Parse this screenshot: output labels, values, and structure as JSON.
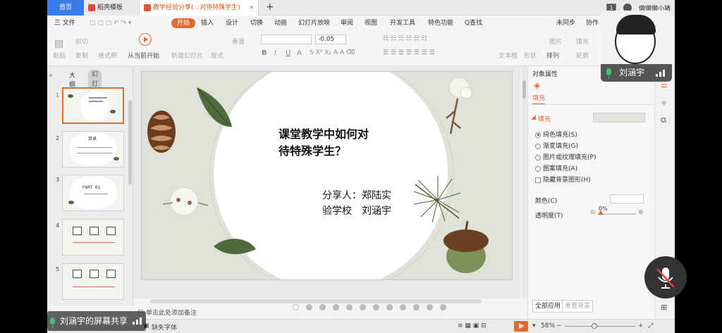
{
  "tabs": {
    "home": "首页",
    "template": "稻壳模板",
    "document": "教学经验分享(...对待特殊学生)"
  },
  "titlebar": {
    "badge": "1",
    "user": "懒懒懒小猪"
  },
  "menu": {
    "file": "三 文件",
    "start": "开始",
    "insert": "插入",
    "design": "设计",
    "switch": "切换",
    "animation": "动画",
    "slideshow": "幻灯片放映",
    "review": "审阅",
    "view": "视图",
    "devtools": "开发工具",
    "special": "特色功能",
    "search": "Q查找",
    "sync": "未同步",
    "collab": "协作",
    "share": "分享"
  },
  "ribbon": {
    "paste": "粘贴",
    "cut": "剪切",
    "copy": "复制",
    "format_painter": "格式刷",
    "play_from_current": "从当前开始",
    "new_slide": "新建幻灯片",
    "layout": "版式",
    "reset": "重置",
    "size": "-0.05",
    "textbox": "文本框",
    "shape": "形状",
    "arrange": "排列",
    "picture": "图片",
    "fill": "填充",
    "outline": "轮廓"
  },
  "left_panel": {
    "outline_tab": "大纲",
    "slides_tab": "幻灯片",
    "thumb_numbers": [
      "1",
      "2",
      "3",
      "4",
      "5"
    ],
    "thumb2_title": "目录",
    "thumb3_title": "PART 01"
  },
  "slide": {
    "title_line1": "课堂教学中如何对",
    "title_line2": "待特殊学生？",
    "share_line1": "分享人：郑陆实",
    "share_line2": "验学校　刘涵宇"
  },
  "notes": {
    "placeholder": "单击此处添加备注"
  },
  "properties": {
    "header": "对象属性",
    "tab_fill": "填充",
    "section_fill": "填充",
    "options": [
      "纯色填充(S)",
      "渐变填充(G)",
      "图片或纹理填充(P)",
      "图案填充(A)"
    ],
    "hide_bg": "隐藏背景图形(H)",
    "color_label": "颜色(C)",
    "transparency_label": "透明度(T)",
    "transparency_value": "0%",
    "apply_all": "全部应用",
    "reset_bg": "重置背景"
  },
  "status": {
    "missing_font": "缺失字体",
    "zoom": "58%"
  },
  "call": {
    "speaker": "刘涵宇",
    "screen_share": "刘涵宇的屏幕共享"
  },
  "colors": {
    "accent": "#e36a2e",
    "tab_blue": "#3b7ce8",
    "slide_bg": "#dfe2d9",
    "mic_green": "#3ec26a"
  }
}
